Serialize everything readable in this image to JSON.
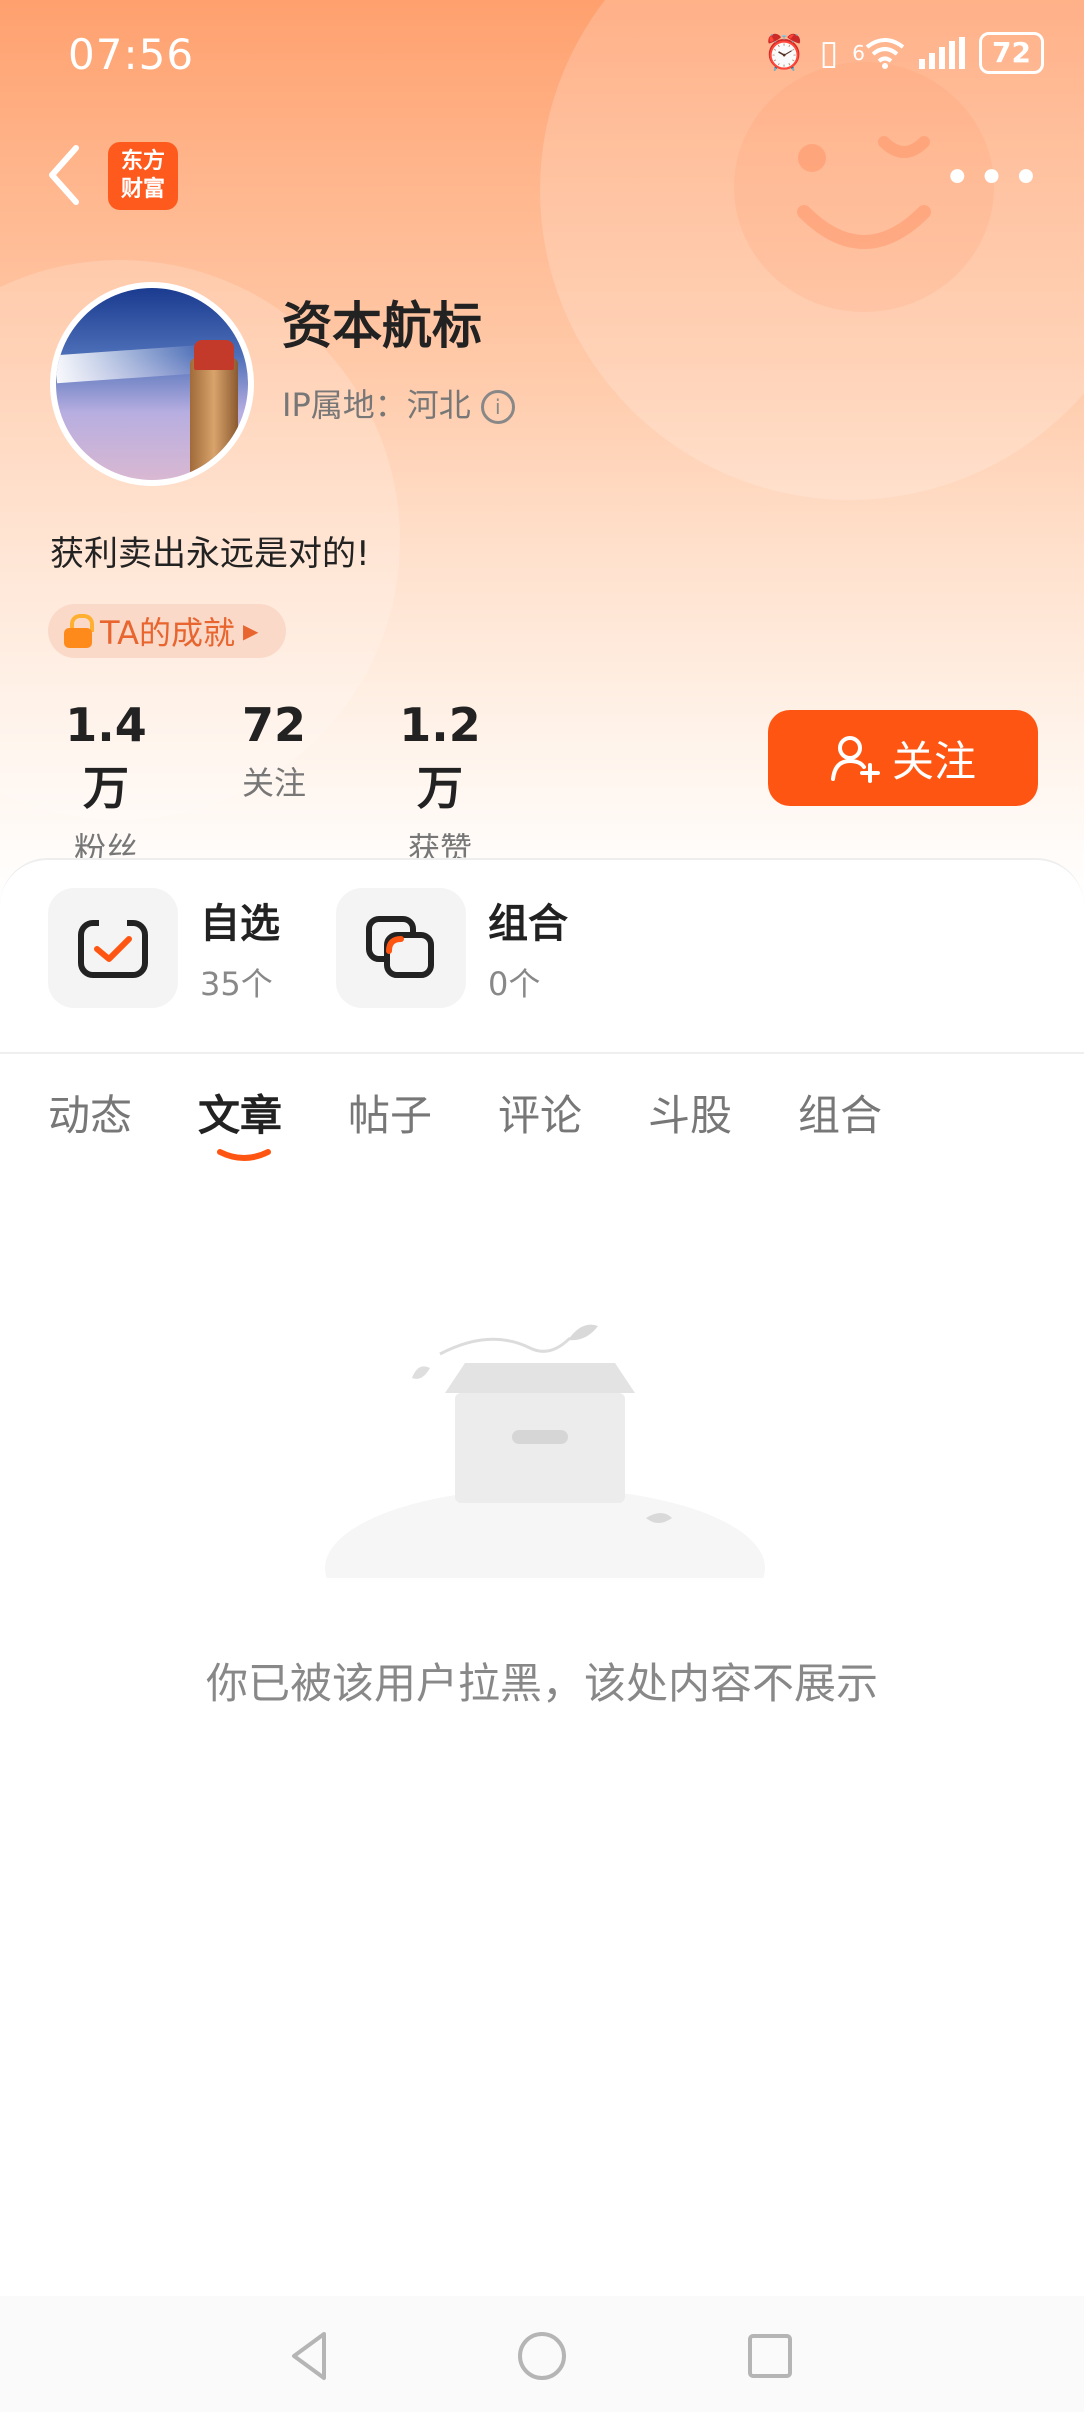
{
  "status_bar": {
    "time": "07:56",
    "network": "6",
    "battery": "72"
  },
  "header": {
    "logo_line1": "东方",
    "logo_line2": "财富"
  },
  "profile": {
    "username": "资本航标",
    "ip_location": "IP属地：河北",
    "bio": "获利卖出永远是对的!",
    "achievement_label": "TA的成就"
  },
  "stats": [
    {
      "value": "1.4万",
      "label": "粉丝"
    },
    {
      "value": "72",
      "label": "关注"
    },
    {
      "value": "1.2万",
      "label": "获赞"
    }
  ],
  "follow_button": {
    "label": "关注"
  },
  "shortcuts": [
    {
      "title": "自选",
      "count": "35个"
    },
    {
      "title": "组合",
      "count": "0个"
    }
  ],
  "tabs": [
    {
      "label": "动态"
    },
    {
      "label": "文章",
      "active": true
    },
    {
      "label": "帖子"
    },
    {
      "label": "评论"
    },
    {
      "label": "斗股"
    },
    {
      "label": "组合"
    }
  ],
  "empty_state": {
    "message": "你已被该用户拉黑，该处内容不展示"
  },
  "colors": {
    "accent": "#ff5512",
    "header_top": "#ffa06e",
    "text_secondary": "#777777"
  }
}
